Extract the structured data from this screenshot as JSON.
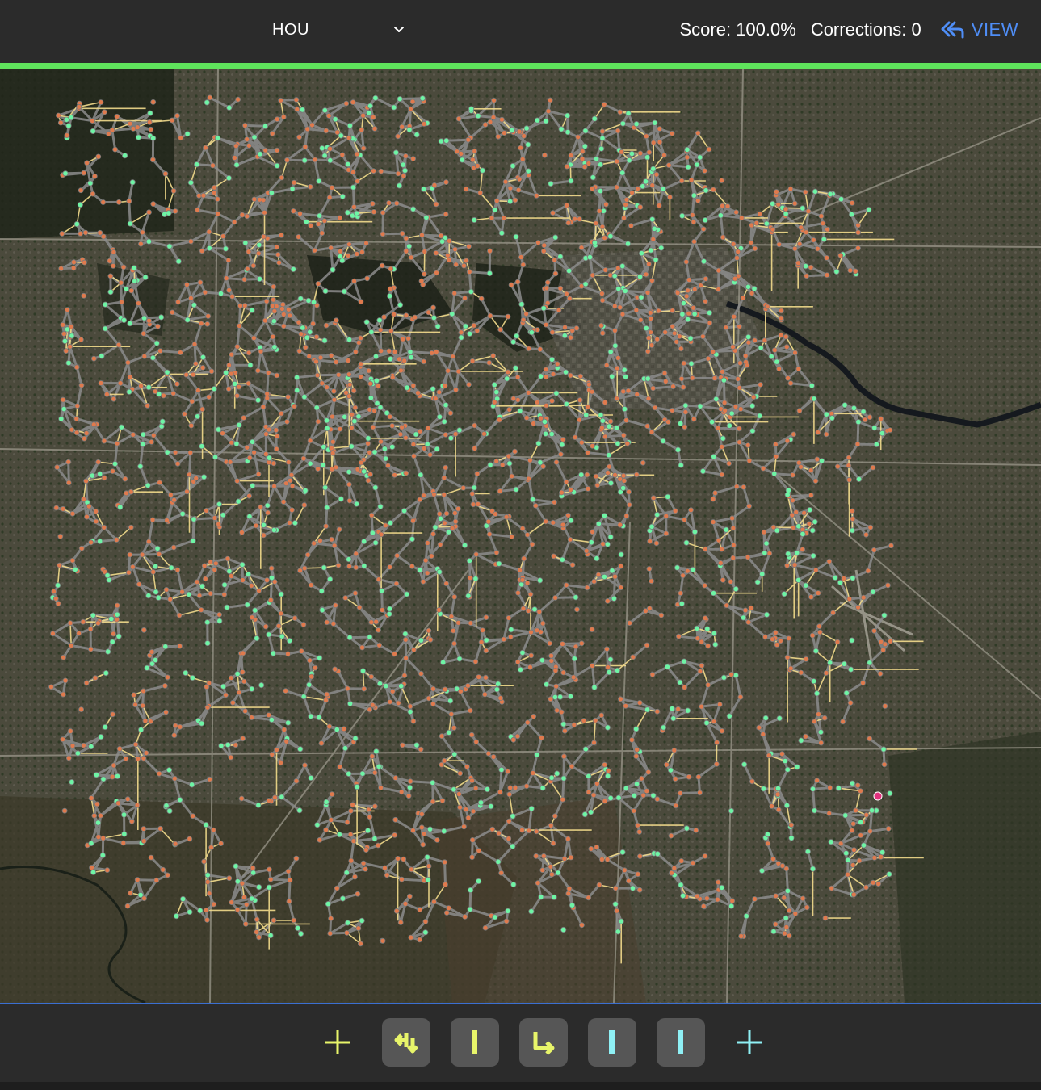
{
  "header": {
    "city": "HOU",
    "score_label": "Score: 100.0%",
    "corrections_label": "Corrections: 0",
    "view_label": "VIEW",
    "progress_fraction": 1.0
  },
  "colors": {
    "header_bg": "#2b2b2b",
    "progress": "#5fe35c",
    "accent_blue": "#4f8ef7",
    "node_orange": "#e07a4d",
    "node_green": "#6ef5a5",
    "edge_gray": "#8c8c8c",
    "edge_yellow": "#f3dc8c",
    "tool_yellow": "#e8f56a",
    "tool_cyan": "#8ff0f5",
    "tool_button_bg": "#565656"
  },
  "toolbar": {
    "tools": [
      {
        "icon": "plus-icon",
        "color": "yellow",
        "boxed": false
      },
      {
        "icon": "merge-arrow-icon",
        "color": "yellow",
        "boxed": true
      },
      {
        "icon": "vertical-bar-icon",
        "color": "yellow",
        "boxed": true
      },
      {
        "icon": "corner-arrow-icon",
        "color": "yellow",
        "boxed": true
      },
      {
        "icon": "vertical-bar-icon",
        "color": "cyan",
        "boxed": true
      },
      {
        "icon": "vertical-bar-icon",
        "color": "cyan",
        "boxed": true
      },
      {
        "icon": "plus-icon",
        "color": "cyan",
        "boxed": false
      }
    ]
  }
}
